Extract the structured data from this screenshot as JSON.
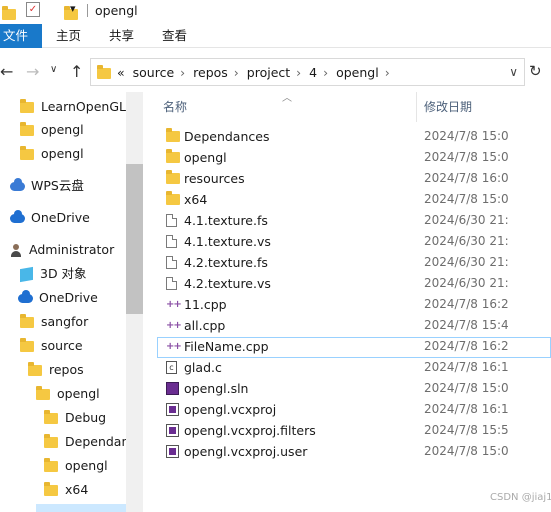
{
  "window": {
    "title": "opengl"
  },
  "ribbon": {
    "tabs": [
      "文件",
      "主页",
      "共享",
      "查看"
    ]
  },
  "nav": {
    "address_prefix": "«",
    "path": [
      "source",
      "repos",
      "project",
      "4",
      "opengl"
    ]
  },
  "sidebar": {
    "items": [
      {
        "label": "LearnOpenGL-r",
        "icon": "folder-icon"
      },
      {
        "label": "opengl",
        "icon": "folder-icon"
      },
      {
        "label": "opengl",
        "icon": "folder-icon"
      },
      {
        "label": "WPS云盘",
        "icon": "cloud-icon"
      },
      {
        "label": "OneDrive",
        "icon": "cloud-icon"
      },
      {
        "label": "Administrator",
        "icon": "user-icon"
      },
      {
        "label": "3D 对象",
        "icon": "cube-icon"
      },
      {
        "label": "OneDrive",
        "icon": "cloud-icon"
      },
      {
        "label": "sangfor",
        "icon": "folder-icon"
      },
      {
        "label": "source",
        "icon": "folder-icon"
      },
      {
        "label": "repos",
        "icon": "folder-icon"
      },
      {
        "label": "opengl",
        "icon": "folder-icon"
      },
      {
        "label": "Debug",
        "icon": "folder-icon"
      },
      {
        "label": "Dependanc",
        "icon": "folder-icon"
      },
      {
        "label": "opengl",
        "icon": "folder-icon"
      },
      {
        "label": "x64",
        "icon": "folder-icon"
      }
    ]
  },
  "list": {
    "columns": {
      "name": "名称",
      "date": "修改日期"
    },
    "rows": [
      {
        "name": "Dependances",
        "date": "2024/7/8 15:0",
        "type": "folder"
      },
      {
        "name": "opengl",
        "date": "2024/7/8 15:0",
        "type": "folder"
      },
      {
        "name": "resources",
        "date": "2024/7/8 16:0",
        "type": "folder"
      },
      {
        "name": "x64",
        "date": "2024/7/8 15:0",
        "type": "folder"
      },
      {
        "name": "4.1.texture.fs",
        "date": "2024/6/30 21:",
        "type": "file"
      },
      {
        "name": "4.1.texture.vs",
        "date": "2024/6/30 21:",
        "type": "file"
      },
      {
        "name": "4.2.texture.fs",
        "date": "2024/6/30 21:",
        "type": "file"
      },
      {
        "name": "4.2.texture.vs",
        "date": "2024/6/30 21:",
        "type": "file"
      },
      {
        "name": "11.cpp",
        "date": "2024/7/8 16:2",
        "type": "cpp"
      },
      {
        "name": "all.cpp",
        "date": "2024/7/8 15:4",
        "type": "cpp"
      },
      {
        "name": "FileName.cpp",
        "date": "2024/7/8 16:2",
        "type": "cpp"
      },
      {
        "name": "glad.c",
        "date": "2024/7/8 16:1",
        "type": "c"
      },
      {
        "name": "opengl.sln",
        "date": "2024/7/8 15:0",
        "type": "sln"
      },
      {
        "name": "opengl.vcxproj",
        "date": "2024/7/8 16:1",
        "type": "proj"
      },
      {
        "name": "opengl.vcxproj.filters",
        "date": "2024/7/8 15:5",
        "type": "proj"
      },
      {
        "name": "opengl.vcxproj.user",
        "date": "2024/7/8 15:0",
        "type": "proj"
      }
    ]
  },
  "watermark": "CSDN @jiaj1",
  "colors": {
    "accent": "#1979ca",
    "folder": "#f5c842",
    "selection_border": "#99d1ff"
  }
}
